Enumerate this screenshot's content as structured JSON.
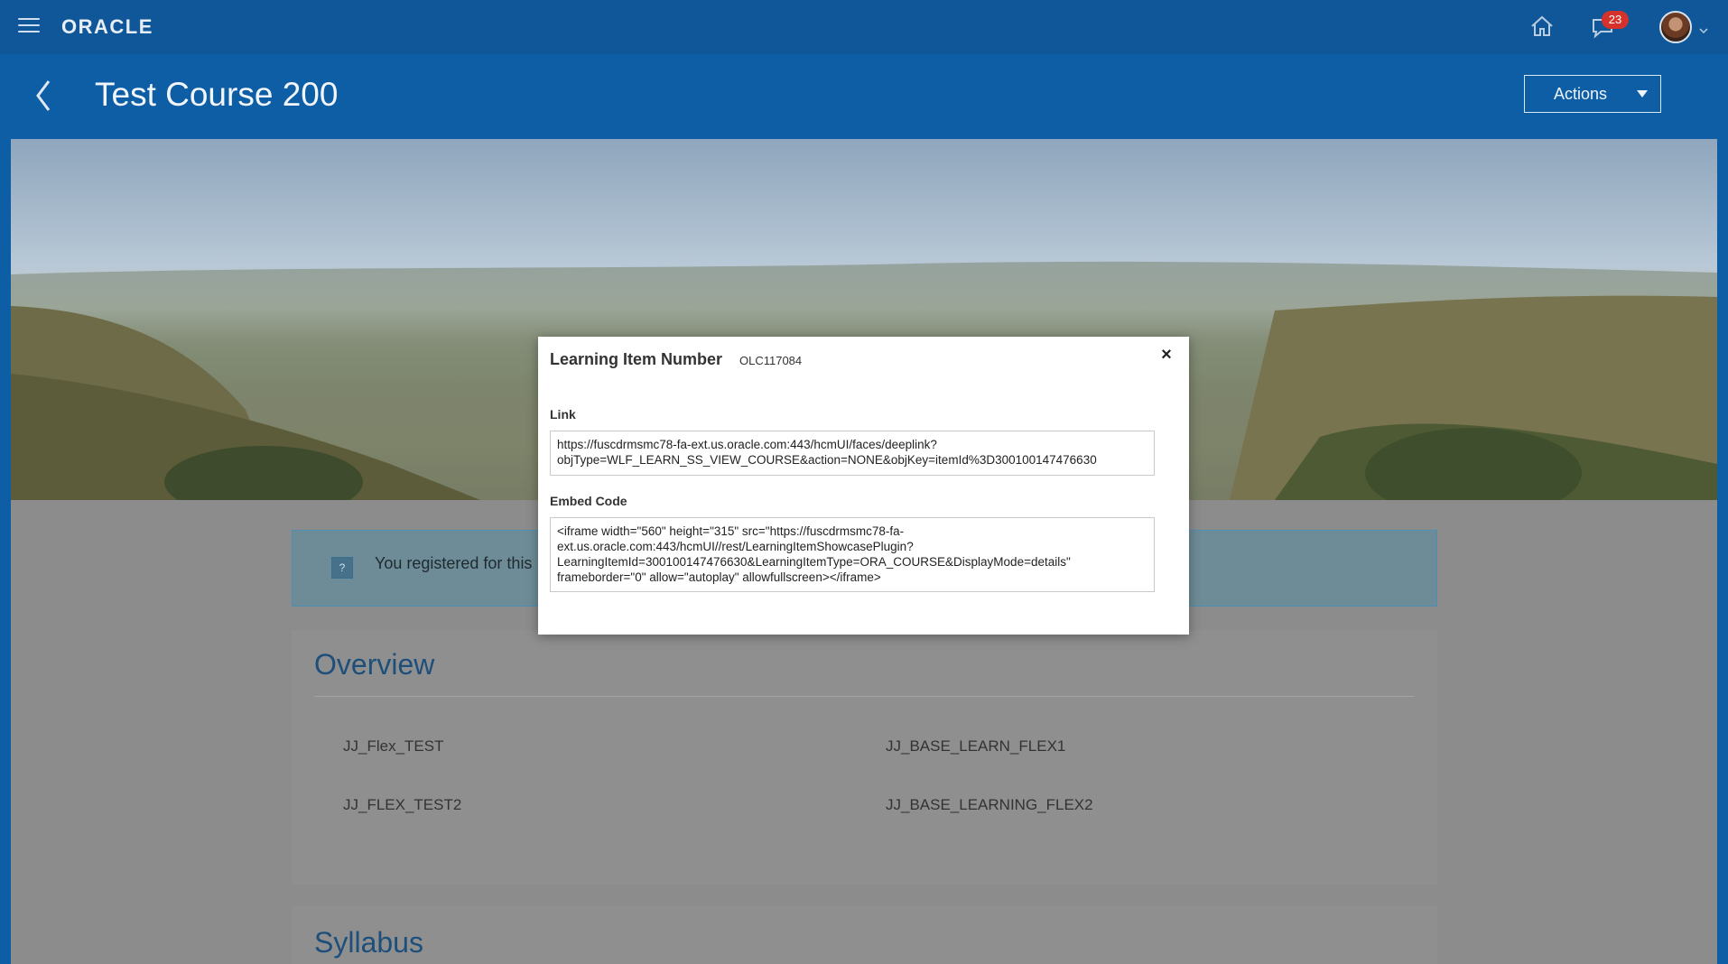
{
  "app": {
    "logo": "ORACLE",
    "notification_count": "23"
  },
  "header": {
    "title": "Test Course 200",
    "actions_label": "Actions"
  },
  "registration": {
    "message": "You registered for this"
  },
  "overview": {
    "title": "Overview",
    "items": [
      "JJ_Flex_TEST",
      "JJ_BASE_LEARN_FLEX1",
      "JJ_FLEX_TEST2",
      "JJ_BASE_LEARNING_FLEX2"
    ]
  },
  "syllabus": {
    "title": "Syllabus"
  },
  "modal": {
    "title": "Learning Item Number",
    "number": "OLC117084",
    "close_label": "×",
    "link_label": "Link",
    "link_value": "https://fuscdrmsmc78-fa-ext.us.oracle.com:443/hcmUI/faces/deeplink?\nobjType=WLF_LEARN_SS_VIEW_COURSE&action=NONE&objKey=itemId%3D300100147476630",
    "embed_label": "Embed Code",
    "embed_value": "<iframe width=\"560\" height=\"315\" src=\"https://fuscdrmsmc78-fa-\next.us.oracle.com:443/hcmUI//rest/LearningItemShowcasePlugin?\nLearningItemId=300100147476630&LearningItemType=ORA_COURSE&DisplayMode=details\"\nframeborder=\"0\" allow=\"autoplay\" allowfullscreen></iframe>"
  },
  "colors": {
    "brand_blue": "#0e5ea6",
    "overlay_gray": "#8c8c8c",
    "badge_red": "#d6312b",
    "title_blue": "#1d4f7a"
  },
  "icons": [
    "hamburger-icon",
    "home-icon",
    "notification-icon",
    "avatar",
    "chevron-left-icon",
    "caret-down-icon",
    "info-icon",
    "close-icon"
  ]
}
